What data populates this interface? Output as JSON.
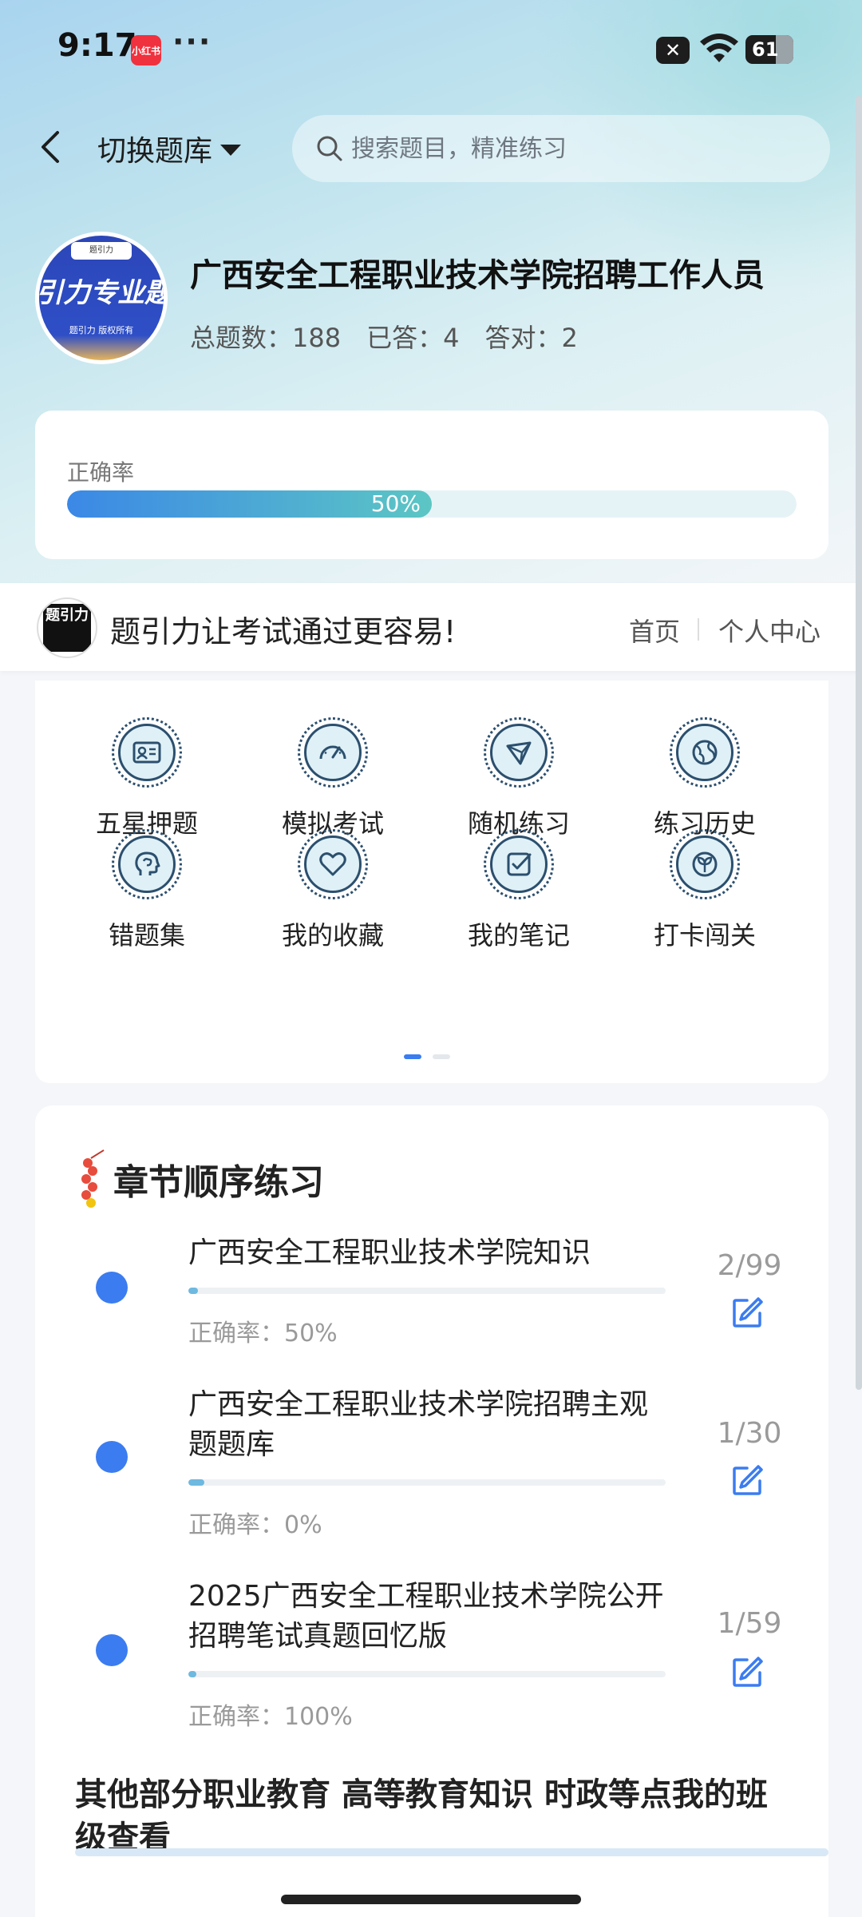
{
  "status_bar": {
    "time": "9:17",
    "app_badge": "小红书",
    "more": "···",
    "battery": "61"
  },
  "header": {
    "back_icon": "chevron-left-icon",
    "switch_label": "切换题库",
    "search_placeholder": "搜索题目，精准练习"
  },
  "bank": {
    "logo_top": "题引力",
    "logo_main": "引力专业题",
    "logo_sub": "题引力 版权所有",
    "title": "广西安全工程职业技术学院招聘工作人员",
    "stats": {
      "total_label": "总题数：188",
      "answered_label": "已答：4",
      "correct_label": "答对：2"
    }
  },
  "accuracy": {
    "label": "正确率",
    "value_text": "50%",
    "fraction": 0.5
  },
  "slogan": {
    "text": "题引力让考试通过更容易!",
    "logo_glyph": "题引力",
    "nav_home": "首页",
    "nav_me": "个人中心"
  },
  "features": [
    {
      "label": "五星押题",
      "icon": "id-card-icon"
    },
    {
      "label": "模拟考试",
      "icon": "speedometer-icon"
    },
    {
      "label": "随机练习",
      "icon": "shuffle-network-icon"
    },
    {
      "label": "练习历史",
      "icon": "globe-icon"
    },
    {
      "label": "错题集",
      "icon": "head-brain-icon"
    },
    {
      "label": "我的收藏",
      "icon": "heart-icon"
    },
    {
      "label": "我的笔记",
      "icon": "note-check-icon"
    },
    {
      "label": "打卡闯关",
      "icon": "leaf-badge-icon"
    }
  ],
  "chapter": {
    "title": "章节顺序练习",
    "items": [
      {
        "title": "广西安全工程职业技术学院知识",
        "accuracy": "正确率：50%",
        "progress": "2/99",
        "fraction": 0.0202
      },
      {
        "title": "广西安全工程职业技术学院招聘主观题题库",
        "accuracy": "正确率：0%",
        "progress": "1/30",
        "fraction": 0.0333
      },
      {
        "title": "2025广西安全工程职业技术学院公开招聘笔试真题回忆版",
        "accuracy": "正确率：100%",
        "progress": "1/59",
        "fraction": 0.0169
      }
    ],
    "more_note": "其他部分职业教育 高等教育知识 时政等点我的班级查看"
  },
  "colors": {
    "accent": "#3b7cf0",
    "progress_start": "#3b88e6",
    "progress_end": "#5cc6c4",
    "icon_stroke": "#2c4f6e"
  }
}
